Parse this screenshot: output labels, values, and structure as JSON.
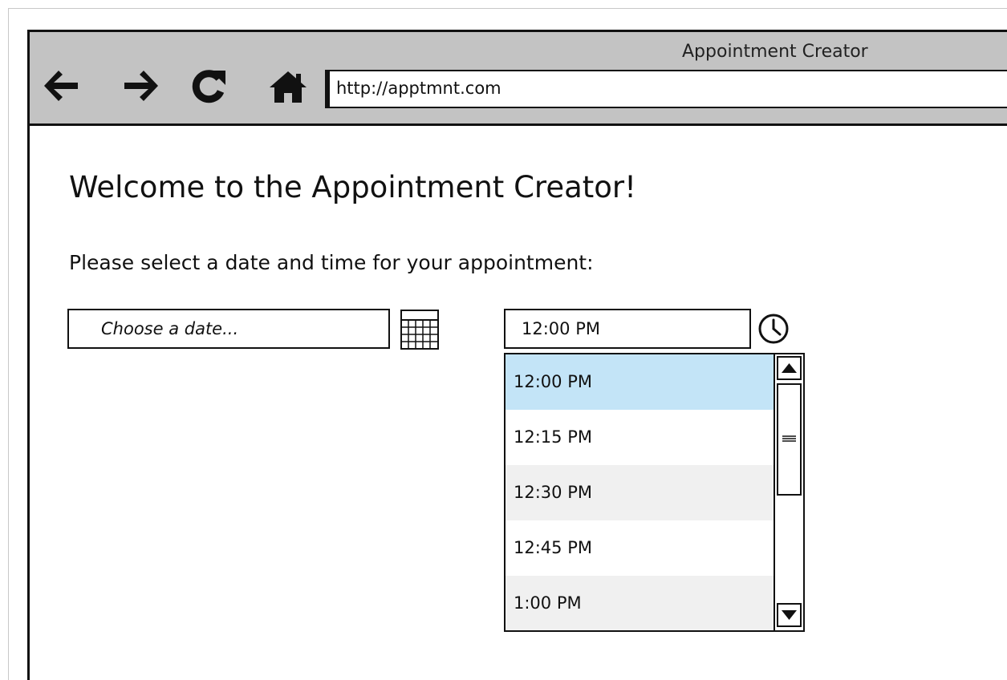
{
  "window": {
    "title": "Appointment Creator"
  },
  "toolbar": {
    "back_icon": "arrow-left-icon",
    "forward_icon": "arrow-right-icon",
    "reload_icon": "reload-icon",
    "home_icon": "home-icon",
    "url": "http://apptmnt.com"
  },
  "main": {
    "title": "Welcome to the Appointment Creator!",
    "instruction": "Please select a date and time for your appointment:",
    "date_field": {
      "placeholder": "Choose a date...",
      "icon": "calendar-icon"
    },
    "time_field": {
      "value": "12:00 PM",
      "icon": "clock-icon"
    },
    "time_dropdown": {
      "options": [
        "12:00 PM",
        "12:15 PM",
        "12:30 PM",
        "12:45 PM",
        "1:00 PM"
      ],
      "selected": "12:00 PM",
      "highlight_color": "#c3e4f7",
      "alt_row_color": "#f0f0f0"
    }
  },
  "colors": {
    "toolbar": "#c3c3c3",
    "border": "#111111"
  }
}
